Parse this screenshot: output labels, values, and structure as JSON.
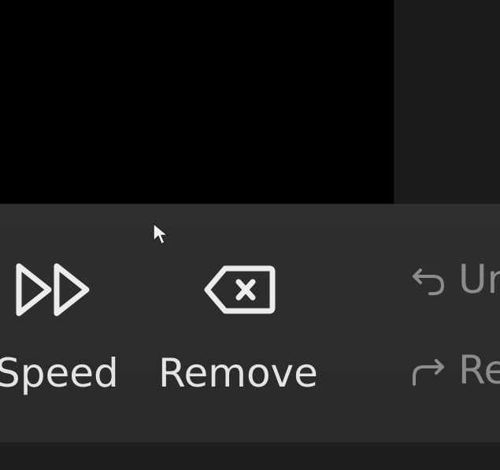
{
  "toolbar": {
    "speed_label": "Speed",
    "remove_label": "Remove",
    "undo_label": "Undo",
    "redo_label": "Redo"
  },
  "icons": {
    "speed": "fast-forward-icon",
    "remove": "backspace-delete-icon",
    "undo": "undo-arrow-icon",
    "redo": "redo-arrow-icon",
    "cursor": "mouse-pointer-icon"
  },
  "colors": {
    "toolbar_bg": "#2f2f2f",
    "canvas_bg": "#000000",
    "icon_fg": "#e6e6e6",
    "disabled_fg": "#8c8c8c"
  }
}
